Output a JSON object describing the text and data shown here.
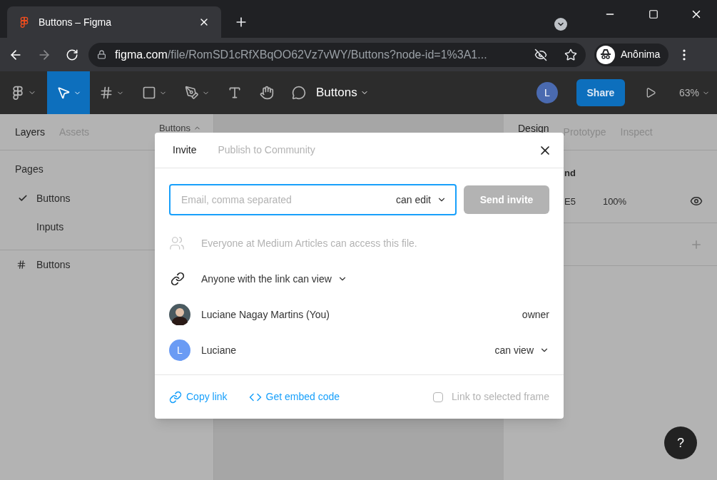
{
  "browser": {
    "tab_title": "Buttons – Figma",
    "url_domain": "figma.com",
    "url_path": "/file/RomSD1cRfXBqOO62Vz7vWY/Buttons?node-id=1%3A1...",
    "profile": "Anônima"
  },
  "toolbar": {
    "tools": [
      {
        "kind": "move",
        "selected": true,
        "caret": true
      },
      {
        "kind": "frame",
        "selected": false,
        "caret": true
      },
      {
        "kind": "shape",
        "selected": false,
        "caret": true
      },
      {
        "kind": "pen",
        "selected": false,
        "caret": true
      },
      {
        "kind": "text",
        "selected": false,
        "caret": false
      },
      {
        "kind": "hand",
        "selected": false,
        "caret": false
      },
      {
        "kind": "comment",
        "selected": false,
        "caret": false
      }
    ],
    "file_name": "Buttons",
    "user_initial": "L",
    "share": "Share",
    "zoom": "63%"
  },
  "left_panel": {
    "tabs": [
      {
        "label": "Layers",
        "selected": true
      },
      {
        "label": "Assets",
        "selected": false
      }
    ],
    "page_menu": "Buttons",
    "pages_title": "Pages",
    "pages": [
      {
        "name": "Buttons",
        "selected": true
      },
      {
        "name": "Inputs",
        "selected": false
      }
    ],
    "layers": [
      {
        "name": "Buttons"
      }
    ]
  },
  "right_panel": {
    "tabs": [
      {
        "label": "Design",
        "selected": true
      },
      {
        "label": "Prototype",
        "selected": false
      },
      {
        "label": "Inspect",
        "selected": false
      }
    ],
    "section_title": "nd",
    "fill_hex": "E5",
    "fill_opacity": "100%",
    "fill_visible": true
  },
  "dialog": {
    "tabs": [
      {
        "label": "Invite",
        "selected": true
      },
      {
        "label": "Publish to Community",
        "selected": false
      }
    ],
    "email_placeholder": "Email, comma separated",
    "permission": "can edit",
    "send_button": "Send invite",
    "send_disabled": true,
    "team_note": "Everyone at Medium Articles can access this file.",
    "link_access": "Anyone with the link can view",
    "people": [
      {
        "name": "Luciane Nagay Martins (You)",
        "kind": "photo",
        "role": "owner",
        "role_menu": false
      },
      {
        "name": "Luciane",
        "kind": "initial",
        "initial": "L",
        "role": "can view",
        "role_menu": true
      }
    ],
    "copy_link": "Copy link",
    "embed_code": "Get embed code",
    "frame_link": {
      "label": "Link to selected frame",
      "checked": false
    }
  },
  "help": "?"
}
